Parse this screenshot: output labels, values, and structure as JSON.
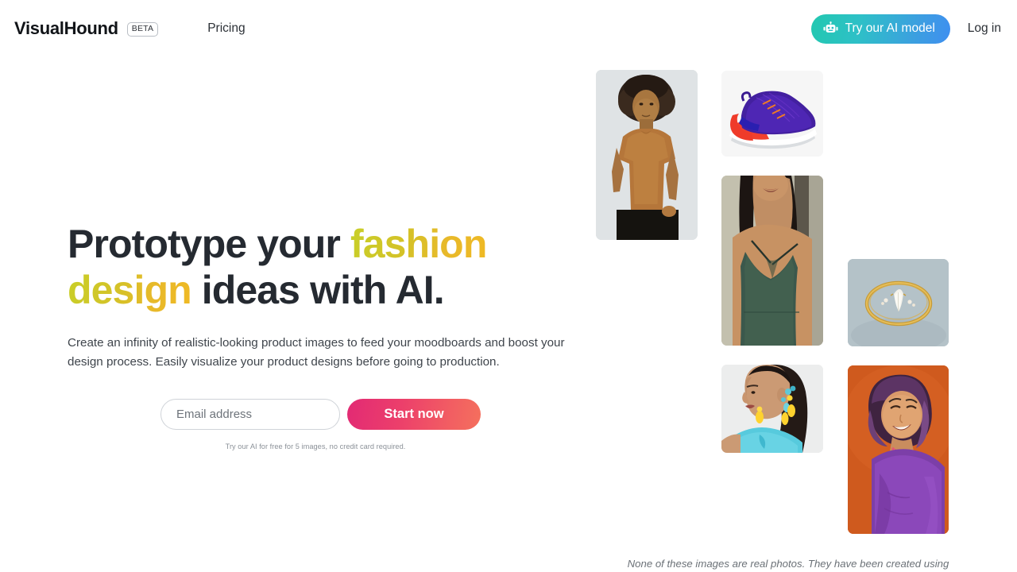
{
  "header": {
    "brand": "VisualHound",
    "beta_badge": "BETA",
    "pricing_label": "Pricing",
    "ai_button_label": "Try our AI model",
    "ai_button_icon": "robot-icon",
    "login_label": "Log in",
    "ai_button_gradient_from": "#22c8b0",
    "ai_button_gradient_to": "#3f8ff0"
  },
  "hero": {
    "headline_part1": "Prototype your ",
    "headline_highlight1": "fashion",
    "headline_part2": " ",
    "headline_highlight2": "design",
    "headline_part3": " ideas with AI.",
    "headline_gradient_from": "#c8cf28",
    "headline_gradient_to": "#efb924",
    "subhead": "Create an infinity of realistic-looking product images to feed your moodboards and boost your design process. Easily visualize your product designs before going to production.",
    "email_placeholder": "Email address",
    "email_value": "",
    "cta_label": "Start now",
    "cta_gradient_from": "#e22a74",
    "cta_gradient_to": "#f4705d",
    "fineprint": "Try our AI for free for 5 images, no credit card required."
  },
  "collage": {
    "disclaimer": "None of these images are real photos. They have been created using",
    "images": [
      {
        "name": "man-in-tan-tshirt",
        "alt": "Man wearing a tan brown t-shirt on light gray background"
      },
      {
        "name": "purple-red-sneaker",
        "alt": "Purple and red running sneaker on white background"
      },
      {
        "name": "woman-in-green-dress",
        "alt": "Woman wearing a dark green silk slip dress"
      },
      {
        "name": "gold-diamond-ring",
        "alt": "Gold ring with marquise diamond on blue-gray background"
      },
      {
        "name": "woman-with-yellow-earrings",
        "alt": "Woman in profile with yellow drop earrings and turquoise scarf"
      },
      {
        "name": "woman-purple-hair-orange-bg",
        "alt": "Smiling woman with purple bob hair in purple top on orange background"
      }
    ]
  }
}
